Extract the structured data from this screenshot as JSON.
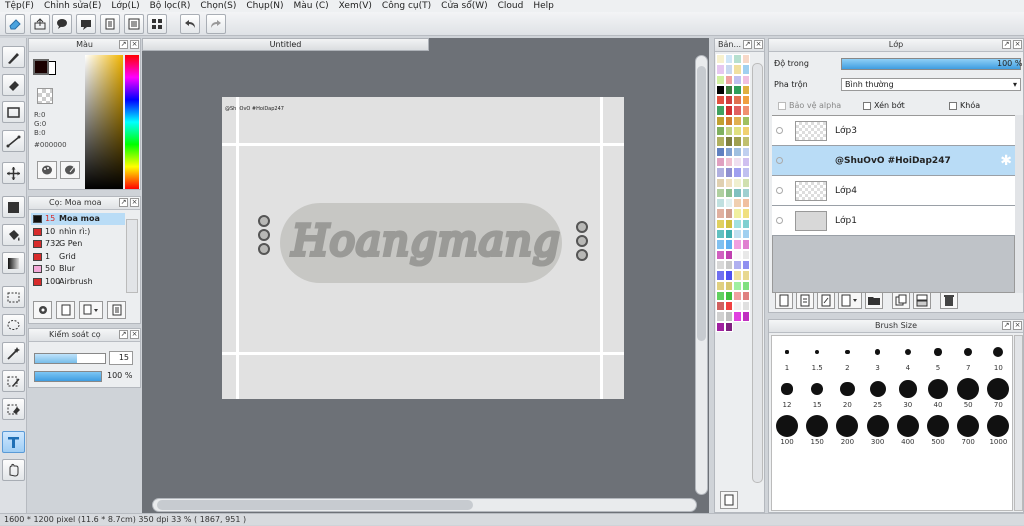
{
  "menu": [
    "Tệp(F)",
    "Chỉnh sửa(E)",
    "Lớp(L)",
    "Bộ lọc(R)",
    "Chọn(S)",
    "Chụp(N)",
    "Màu (C)",
    "Xem(V)",
    "Công cụ(T)",
    "Cửa sổ(W)",
    "Cloud",
    "Help"
  ],
  "color_panel": {
    "title": "Màu",
    "r": "R:0",
    "g": "G:0",
    "b": "B:0",
    "hex": "#000000",
    "fg": "#1a0000",
    "bg": "#ffffff"
  },
  "brush_panel": {
    "title": "Cọ: Moa moa",
    "items": [
      {
        "size": "15",
        "name": "Moa moa",
        "color": "#111111"
      },
      {
        "size": "10",
        "name": "nhìn rì:)",
        "color": "#d72b2b"
      },
      {
        "size": "732",
        "name": "G Pen",
        "color": "#d72b2b"
      },
      {
        "size": "1",
        "name": "Grid",
        "color": "#d72b2b"
      },
      {
        "size": "50",
        "name": "Blur",
        "color": "#f3a8d8"
      },
      {
        "size": "100",
        "name": "Airbrush",
        "color": "#d72b2b"
      }
    ]
  },
  "brush_control": {
    "title": "Kiểm soát cọ",
    "size": "15",
    "opacity": "100 %",
    "opacity_fraction": 1.0
  },
  "document": {
    "tab": "Untitled",
    "watermark": "@ShuOvO #HoiDap247",
    "art_text": "Hoangmang"
  },
  "swatch_panel": {
    "title": "Bản..."
  },
  "layers_panel": {
    "title": "Lớp",
    "opacity_label": "Độ trong",
    "opacity_value": "100 %",
    "opacity_fraction": 1.0,
    "blend_label": "Pha trộn",
    "blend_value": "Bình thường",
    "protect_alpha": "Bảo vệ alpha",
    "clipping": "Xén bớt",
    "lock": "Khóa",
    "layers": [
      {
        "name": "Lớp3",
        "selected": false
      },
      {
        "name": "@ShuOvO #HoiDap247",
        "selected": true
      },
      {
        "name": "Lớp4",
        "selected": false
      },
      {
        "name": "Lớp1",
        "selected": false
      }
    ]
  },
  "brush_size_panel": {
    "title": "Brush Size",
    "sizes": [
      "1",
      "1.5",
      "2",
      "3",
      "4",
      "5",
      "7",
      "10",
      "12",
      "15",
      "20",
      "25",
      "30",
      "40",
      "50",
      "70",
      "100",
      "150",
      "200",
      "300",
      "400",
      "500",
      "700",
      "1000"
    ]
  },
  "status": "1600 * 1200 pixel  (11.6 * 8.7cm)  350 dpi  33 %  ( 1867, 951 )"
}
